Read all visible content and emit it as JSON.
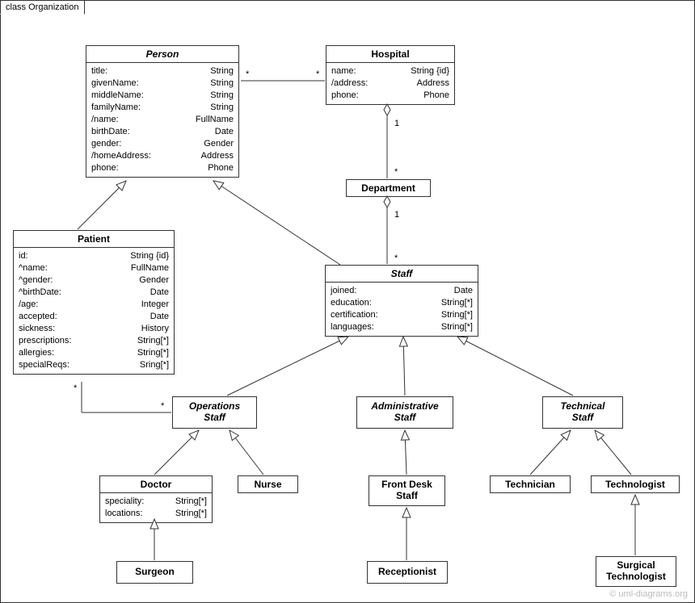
{
  "frame": {
    "title": "class Organization"
  },
  "watermark": "© uml-diagrams.org",
  "classes": {
    "person": {
      "name": "Person",
      "attrs": [
        {
          "n": "title:",
          "t": "String"
        },
        {
          "n": "givenName:",
          "t": "String"
        },
        {
          "n": "middleName:",
          "t": "String"
        },
        {
          "n": "familyName:",
          "t": "String"
        },
        {
          "n": "/name:",
          "t": "FullName"
        },
        {
          "n": "birthDate:",
          "t": "Date"
        },
        {
          "n": "gender:",
          "t": "Gender"
        },
        {
          "n": "/homeAddress:",
          "t": "Address"
        },
        {
          "n": "phone:",
          "t": "Phone"
        }
      ]
    },
    "hospital": {
      "name": "Hospital",
      "attrs": [
        {
          "n": "name:",
          "t": "String {id}"
        },
        {
          "n": "/address:",
          "t": "Address"
        },
        {
          "n": "phone:",
          "t": "Phone"
        }
      ]
    },
    "department": {
      "name": "Department"
    },
    "patient": {
      "name": "Patient",
      "attrs": [
        {
          "n": "id:",
          "t": "String {id}"
        },
        {
          "n": "^name:",
          "t": "FullName"
        },
        {
          "n": "^gender:",
          "t": "Gender"
        },
        {
          "n": "^birthDate:",
          "t": "Date"
        },
        {
          "n": "/age:",
          "t": "Integer"
        },
        {
          "n": "accepted:",
          "t": "Date"
        },
        {
          "n": "sickness:",
          "t": "History"
        },
        {
          "n": "prescriptions:",
          "t": "String[*]"
        },
        {
          "n": "allergies:",
          "t": "String[*]"
        },
        {
          "n": "specialReqs:",
          "t": "Sring[*]"
        }
      ]
    },
    "staff": {
      "name": "Staff",
      "attrs": [
        {
          "n": "joined:",
          "t": "Date"
        },
        {
          "n": "education:",
          "t": "String[*]"
        },
        {
          "n": "certification:",
          "t": "String[*]"
        },
        {
          "n": "languages:",
          "t": "String[*]"
        }
      ]
    },
    "operations": {
      "name": "Operations\nStaff"
    },
    "administrative": {
      "name": "Administrative\nStaff"
    },
    "technical": {
      "name": "Technical\nStaff"
    },
    "doctor": {
      "name": "Doctor",
      "attrs": [
        {
          "n": "speciality:",
          "t": "String[*]"
        },
        {
          "n": "locations:",
          "t": "String[*]"
        }
      ]
    },
    "nurse": {
      "name": "Nurse"
    },
    "frontdesk": {
      "name": "Front Desk\nStaff"
    },
    "technician": {
      "name": "Technician"
    },
    "technologist": {
      "name": "Technologist"
    },
    "surgeon": {
      "name": "Surgeon"
    },
    "receptionist": {
      "name": "Receptionist"
    },
    "surgtech": {
      "name": "Surgical\nTechnologist"
    }
  },
  "mults": {
    "person_hospital_left": "*",
    "person_hospital_right": "*",
    "hospital_dept_top": "1",
    "hospital_dept_bot": "*",
    "dept_staff_top": "1",
    "dept_staff_bot": "*",
    "patient_ops_left": "*",
    "patient_ops_right": "*"
  }
}
